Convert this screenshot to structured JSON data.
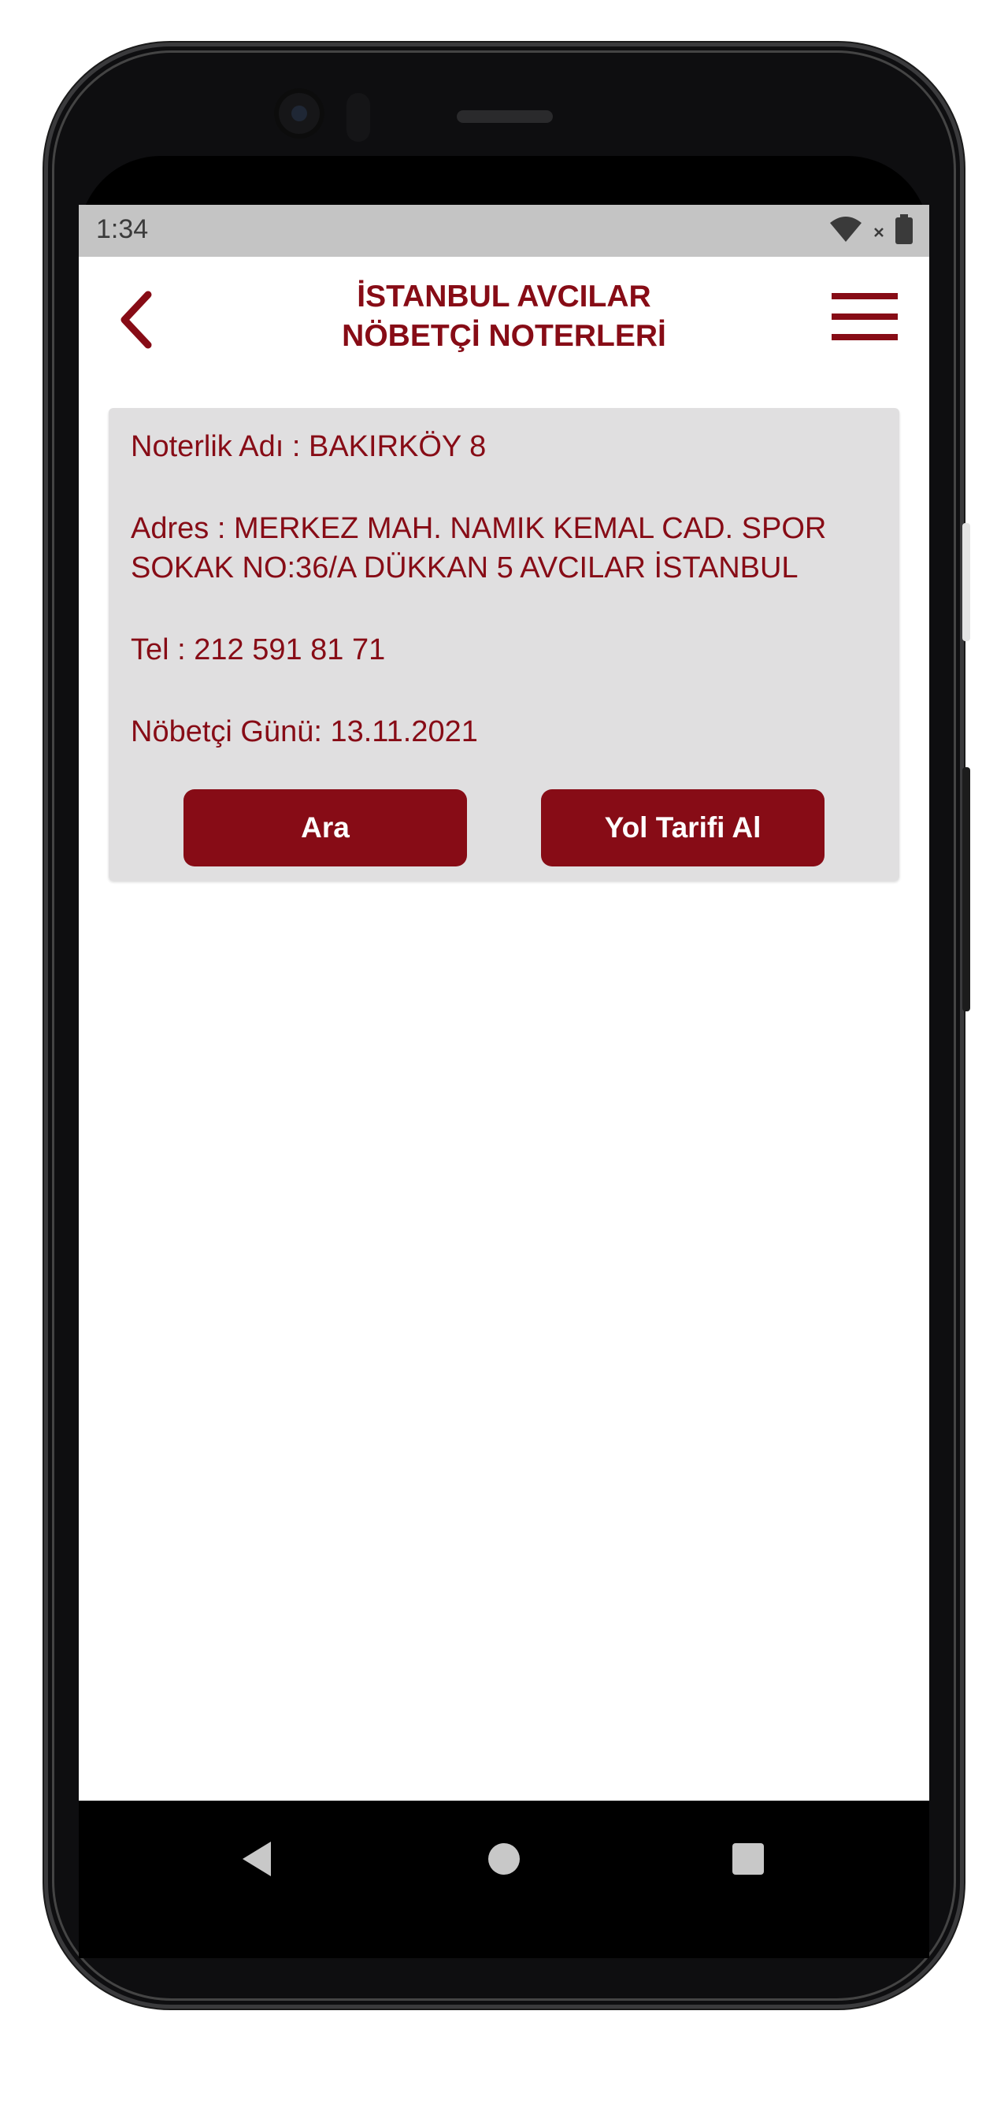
{
  "status_bar": {
    "time": "1:34",
    "icons": [
      "wifi-icon",
      "no-sim-icon",
      "battery-icon"
    ]
  },
  "header": {
    "title_line1": "İSTANBUL AVCILAR",
    "title_line2": "NÖBETÇİ NOTERLERİ",
    "back_icon": "chevron-left-icon",
    "menu_icon": "hamburger-menu-icon"
  },
  "notary": {
    "name_label": "Noterlik Adı : BAKIRKÖY 8",
    "address_line1": "Adres : MERKEZ MAH. NAMIK KEMAL CAD. SPOR",
    "address_line2": "SOKAK NO:36/A DÜKKAN 5 AVCILAR İSTANBUL",
    "phone_label": "Tel : 212 591 81 71",
    "duty_day_label": "Nöbetçi Günü: 13.11.2021"
  },
  "actions": {
    "call_label": "Ara",
    "directions_label": "Yol Tarifi Al"
  },
  "nav_bar": {
    "icons": [
      "back-triangle-icon",
      "home-circle-icon",
      "recents-square-icon"
    ]
  },
  "colors": {
    "accent": "#870c16",
    "card_bg": "#e0dfe0",
    "status_bar_bg": "#c4c4c4"
  }
}
